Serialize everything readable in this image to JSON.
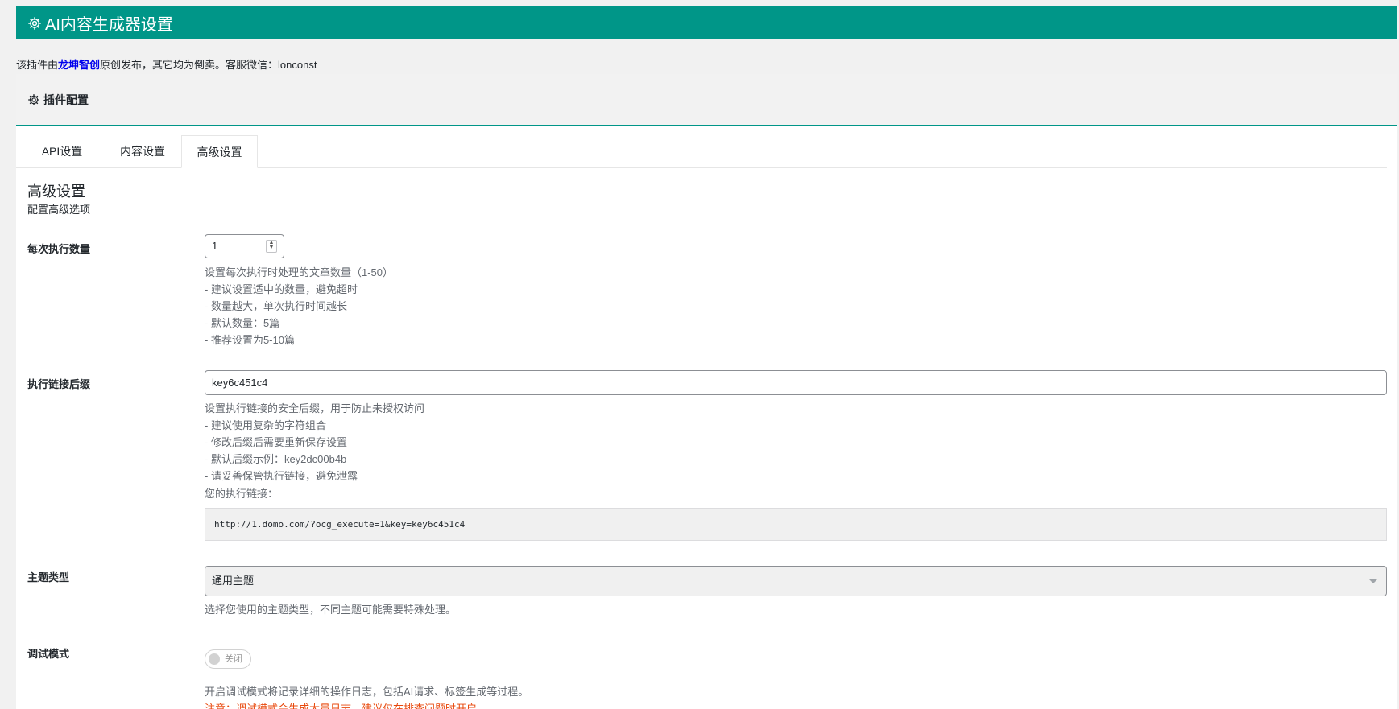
{
  "header": {
    "title": "AI内容生成器设置"
  },
  "notice": {
    "prefix": "该插件由",
    "brand": "龙坤智创",
    "suffix": "原创发布，其它均为倒卖。客服微信：lonconst"
  },
  "panel": {
    "title": "插件配置"
  },
  "tabs": [
    {
      "label": "API设置",
      "active": false
    },
    {
      "label": "内容设置",
      "active": false
    },
    {
      "label": "高级设置",
      "active": true
    }
  ],
  "section": {
    "title": "高级设置",
    "subtitle": "配置高级选项"
  },
  "fields": {
    "batch_count": {
      "label": "每次执行数量",
      "value": "1",
      "desc": [
        "设置每次执行时处理的文章数量（1-50）",
        "- 建议设置适中的数量，避免超时",
        "- 数量越大，单次执行时间越长",
        "- 默认数量：5篇",
        "- 推荐设置为5-10篇"
      ]
    },
    "link_suffix": {
      "label": "执行链接后缀",
      "value": "key6c451c4",
      "desc": [
        "设置执行链接的安全后缀，用于防止未授权访问",
        "- 建议使用复杂的字符组合",
        "- 修改后缀后需要重新保存设置",
        "- 默认后缀示例：key2dc00b4b",
        "- 请妥善保管执行链接，避免泄露"
      ],
      "link_label": "您的执行链接：",
      "link_value": "http://1.domo.com/?ocg_execute=1&key=key6c451c4"
    },
    "theme_type": {
      "label": "主题类型",
      "selected": "通用主题",
      "desc": "选择您使用的主题类型，不同主题可能需要特殊处理。"
    },
    "debug_mode": {
      "label": "调试模式",
      "toggle_label": "关闭",
      "desc": "开启调试模式将记录详细的操作日志，包括AI请求、标签生成等过程。",
      "warning": "注意：调试模式会生成大量日志，建议仅在排查问题时开启。"
    }
  },
  "colors": {
    "accent": "#009688",
    "warning": "#e8480c",
    "link": "#0000ee"
  }
}
